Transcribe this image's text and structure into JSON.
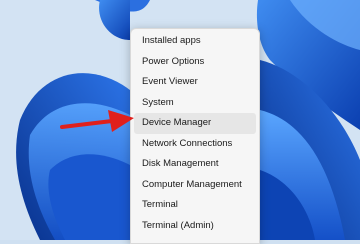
{
  "context_menu": {
    "items": [
      {
        "label": "Installed apps"
      },
      {
        "label": "Power Options"
      },
      {
        "label": "Event Viewer"
      },
      {
        "label": "System"
      },
      {
        "label": "Device Manager"
      },
      {
        "label": "Network Connections"
      },
      {
        "label": "Disk Management"
      },
      {
        "label": "Computer Management"
      },
      {
        "label": "Terminal"
      },
      {
        "label": "Terminal (Admin)"
      }
    ],
    "highlighted_item": "Device Manager"
  },
  "annotation": {
    "arrow_color": "#e0201c",
    "points_to": "Device Manager"
  },
  "colors": {
    "wallpaper_light": "#cfe0f1",
    "wallpaper_blue": "#1f63d6",
    "wallpaper_deep": "#0a3fa8",
    "menu_background": "#f6f6f6"
  }
}
